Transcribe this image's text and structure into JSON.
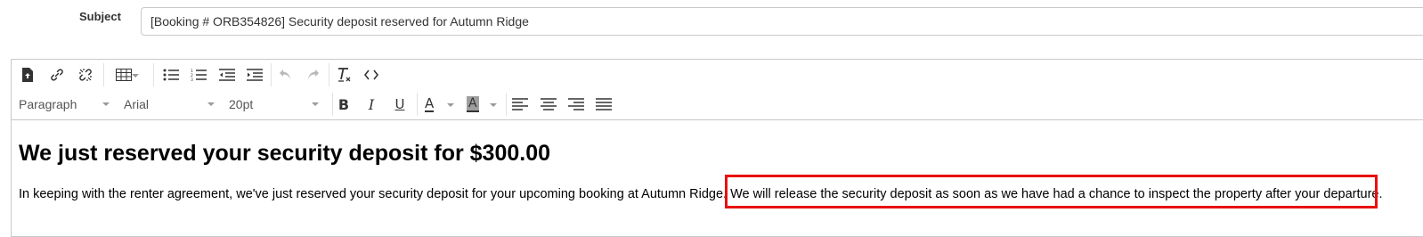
{
  "subject": {
    "label": "Subject",
    "value": "[Booking # ORB354826]  Security deposit reserved for Autumn Ridge"
  },
  "toolbar": {
    "block_format": "Paragraph",
    "font_family": "Arial",
    "font_size": "20pt",
    "bold_label": "B",
    "italic_label": "I",
    "underline_label": "U",
    "text_color_label": "A",
    "bg_color_label": "A",
    "source_code_label": "<>",
    "accent_color": "#e81010"
  },
  "body": {
    "heading": "We just reserved your security deposit for $300.00",
    "paragraph_part1": "In keeping with the renter agreement, we've just reserved your security deposit for your upcoming booking at Autumn Ridge. ",
    "paragraph_part2": "We will release the security deposit as soon as we have had a chance to inspect the property after your departure."
  }
}
